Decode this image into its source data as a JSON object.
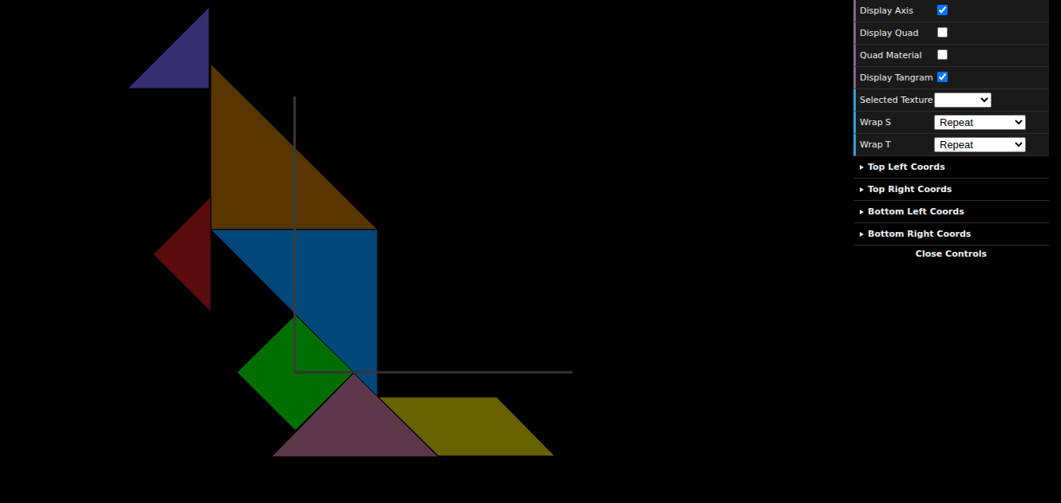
{
  "scene": {
    "axes": {
      "visible": true
    },
    "quad": {
      "visible": false
    },
    "tangram": {
      "visible": true,
      "pieces": [
        {
          "shape": "small-triangle-top",
          "color": "#352f70"
        },
        {
          "shape": "large-triangle",
          "color": "#593500"
        },
        {
          "shape": "small-triangle-left",
          "color": "#5a0c0e"
        },
        {
          "shape": "large-triangle-blue",
          "color": "#00477a"
        },
        {
          "shape": "square",
          "color": "#006f00"
        },
        {
          "shape": "medium-triangle",
          "color": "#5c3649"
        },
        {
          "shape": "parallelogram",
          "color": "#676100"
        }
      ]
    }
  },
  "controls": [
    {
      "kind": "checkbox",
      "label": "Display Axis",
      "checked": true
    },
    {
      "kind": "checkbox",
      "label": "Display Quad",
      "checked": false
    },
    {
      "kind": "checkbox",
      "label": "Quad Material",
      "checked": false
    },
    {
      "kind": "checkbox",
      "label": "Display Tangram",
      "checked": true
    },
    {
      "kind": "select",
      "label": "Selected Texture",
      "value": ""
    },
    {
      "kind": "select",
      "label": "Wrap S",
      "value": "Repeat"
    },
    {
      "kind": "select",
      "label": "Wrap T",
      "value": "Repeat"
    },
    {
      "kind": "folder",
      "label": "Top Left Coords",
      "expanded": false
    },
    {
      "kind": "folder",
      "label": "Top Right Coords",
      "expanded": false
    },
    {
      "kind": "folder",
      "label": "Bottom Left Coords",
      "expanded": false
    },
    {
      "kind": "folder",
      "label": "Bottom Right Coords",
      "expanded": false
    }
  ],
  "close_button": "Close Controls"
}
